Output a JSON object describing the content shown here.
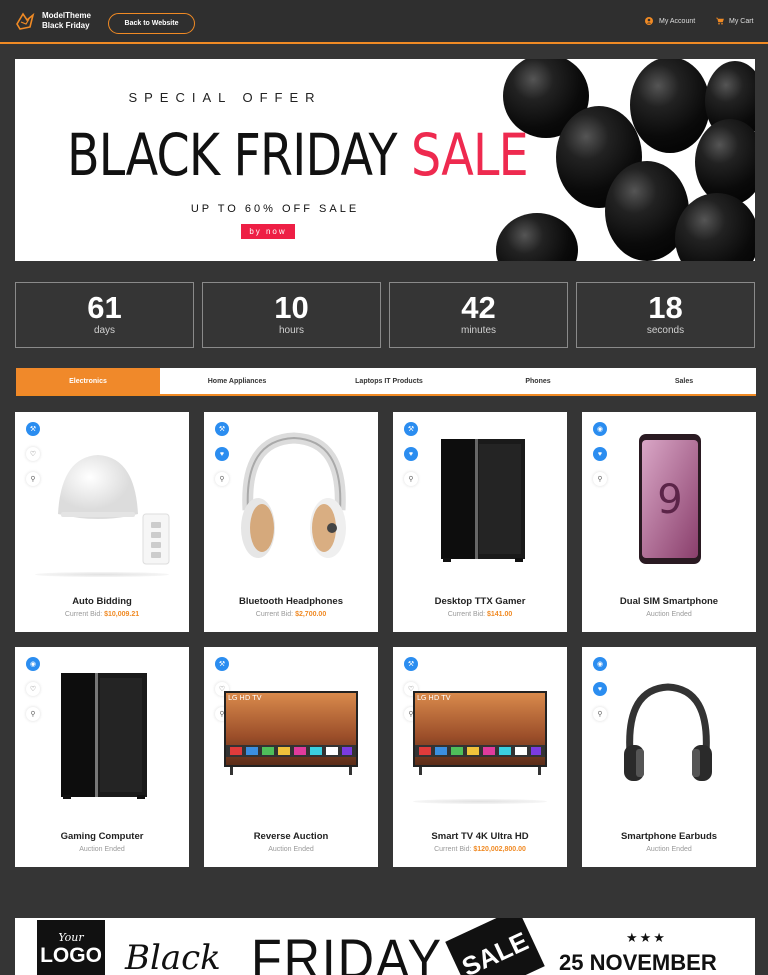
{
  "header": {
    "brand_line1": "ModelTheme",
    "brand_line2": "Black Friday",
    "back_button": "Back to Website",
    "account_link": "My Account",
    "cart_link": "My Cart"
  },
  "banner": {
    "special": "SPECIAL OFFER",
    "title_part1": "BLACK FRIDAY",
    "title_part2": "SALE",
    "subtitle": "UP TO 60% OFF SALE",
    "cta": "by now"
  },
  "countdown": [
    {
      "value": "61",
      "label": "days"
    },
    {
      "value": "10",
      "label": "hours"
    },
    {
      "value": "42",
      "label": "minutes"
    },
    {
      "value": "18",
      "label": "seconds"
    }
  ],
  "tabs": [
    "Electronics",
    "Home Appliances",
    "Laptops IT Products",
    "Phones",
    "Sales"
  ],
  "products": [
    {
      "name": "Auto Bidding",
      "status": "Current Bid:",
      "amount": "$10,009.21"
    },
    {
      "name": "Bluetooth Headphones",
      "status": "Current Bid:",
      "amount": "$2,700.00"
    },
    {
      "name": "Desktop TTX Gamer",
      "status": "Current Bid:",
      "amount": "$141.00"
    },
    {
      "name": "Dual SIM Smartphone",
      "status": "Auction Ended",
      "amount": ""
    },
    {
      "name": "Gaming Computer",
      "status": "Auction Ended",
      "amount": ""
    },
    {
      "name": "Reverse Auction",
      "status": "Auction Ended",
      "amount": ""
    },
    {
      "name": "Smart TV 4K Ultra HD",
      "status": "Current Bid:",
      "amount": "$120,002,800.00"
    },
    {
      "name": "Smartphone Earbuds",
      "status": "Auction Ended",
      "amount": ""
    }
  ],
  "tv_brand": "LG HD TV",
  "bottom_banner": {
    "logo_your": "Your",
    "logo_text": "LOGO",
    "black": "Black",
    "friday": "FRIDAY",
    "tag": "SALE",
    "stars": "★★★",
    "date": "25 NOVEMBER"
  },
  "colors": {
    "accent": "#f08a24",
    "sale_red": "#ee2a4f",
    "icon_blue": "#2b8df0",
    "background": "#353535"
  }
}
